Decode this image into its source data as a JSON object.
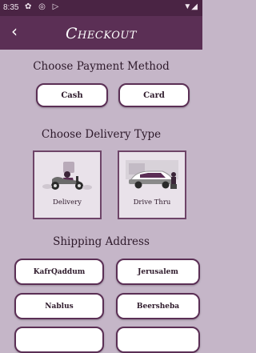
{
  "status_bar": {
    "time": "8:35",
    "left_icons": "✿ ◎ ▷",
    "right_icons": "▼◢"
  },
  "app_bar": {
    "title": "Checkout",
    "back_icon": "chevron-left-icon"
  },
  "payment": {
    "heading": "Choose Payment Method",
    "options": [
      "Cash",
      "Card"
    ]
  },
  "delivery": {
    "heading": "Choose Delivery Type",
    "options": [
      {
        "label": "Delivery",
        "icon": "scooter-rider-illustration"
      },
      {
        "label": "Drive Thru",
        "icon": "car-drive-thru-illustration"
      }
    ]
  },
  "shipping": {
    "heading": "Shipping Address",
    "addresses": [
      "KafrQaddum",
      "Jerusalem",
      "Nablus",
      "Beersheba"
    ]
  },
  "colors": {
    "accent": "#5b2f55",
    "background": "#c5b6c8",
    "statusbar": "#4a2444"
  }
}
